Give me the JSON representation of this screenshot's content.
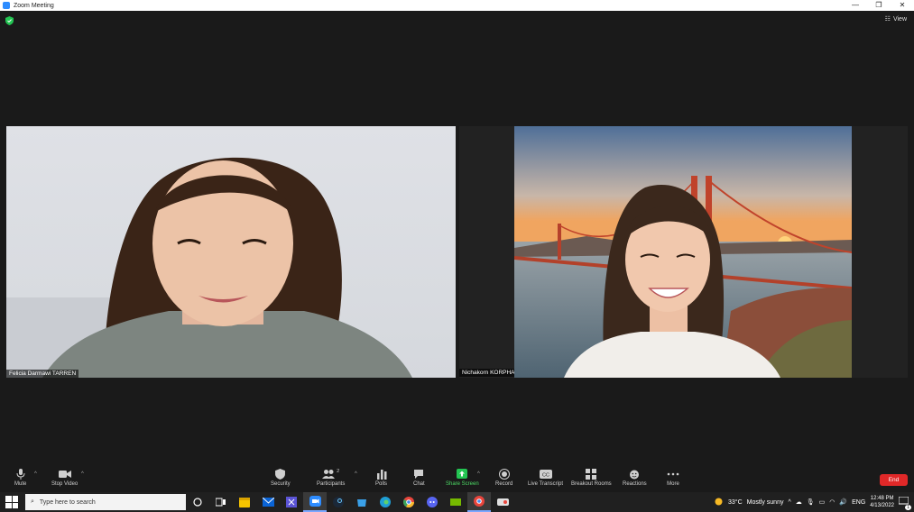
{
  "window": {
    "title": "Zoom Meeting"
  },
  "header": {
    "view_label": "View"
  },
  "participants": [
    {
      "name": "Felicia Darmawi TARREN"
    },
    {
      "name": "Nichakorn KORPHAI"
    }
  ],
  "toolbar": {
    "mute": "Mute",
    "stop_video": "Stop Video",
    "security": "Security",
    "participants": "Participants",
    "participants_count": "2",
    "polls": "Polls",
    "chat": "Chat",
    "share_screen": "Share Screen",
    "record": "Record",
    "live_transcript": "Live Transcript",
    "breakout_rooms": "Breakout Rooms",
    "reactions": "Reactions",
    "more": "More",
    "end": "End"
  },
  "taskbar": {
    "search_placeholder": "Type here to search",
    "weather_temp": "33°C",
    "weather_desc": "Mostly sunny",
    "language": "ENG",
    "time": "12:48 PM",
    "date": "4/13/2022",
    "notification_count": "1"
  },
  "colors": {
    "accent": "#2d8cff",
    "end": "#e02828",
    "share": "#4cd964",
    "background": "#1a1a1a"
  }
}
